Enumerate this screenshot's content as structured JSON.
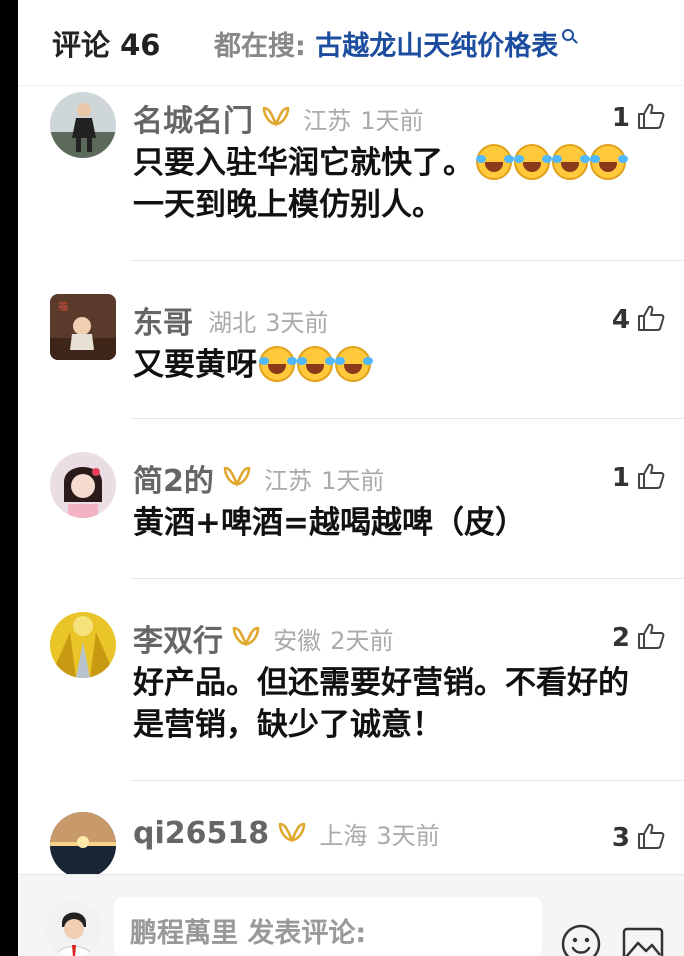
{
  "header": {
    "title": "评论 46",
    "search_prefix": "都在搜:",
    "search_query": "古越龙山天纯价格表"
  },
  "comments": [
    {
      "name": "名城名门",
      "vip": true,
      "location": "江苏",
      "time": "1天前",
      "likes": "1",
      "text": "只要入驻华润它就快了。",
      "emojis_after_line1": 4,
      "text_line2": "一天到晚上模仿别人。"
    },
    {
      "name": "东哥",
      "vip": false,
      "location": "湖北",
      "time": "3天前",
      "likes": "4",
      "text": "又要黄呀",
      "emojis_after_line1": 3
    },
    {
      "name": "简2的",
      "vip": true,
      "location": "江苏",
      "time": "1天前",
      "likes": "1",
      "text": "黄酒+啤酒=越喝越啤（皮）"
    },
    {
      "name": "李双行",
      "vip": true,
      "location": "安徽",
      "time": "2天前",
      "likes": "2",
      "text": "好产品。但还需要好营销。不看好的",
      "text_line2": "是营销，缺少了诚意！"
    },
    {
      "name": "qi26518",
      "vip": true,
      "location": "上海",
      "time": "3天前",
      "likes": "3"
    }
  ],
  "bottom": {
    "placeholder": "鹏程萬里 发表评论:"
  },
  "icons": {
    "search": "search-icon",
    "like": "thumbs-up-icon",
    "vip": "vip-badge-icon",
    "emoji": "emoji-icon",
    "image": "image-icon"
  },
  "colors": {
    "link_blue": "#1d4d9e",
    "vip_gold": "#e0a82e",
    "meta_gray": "#aaaaaa"
  }
}
